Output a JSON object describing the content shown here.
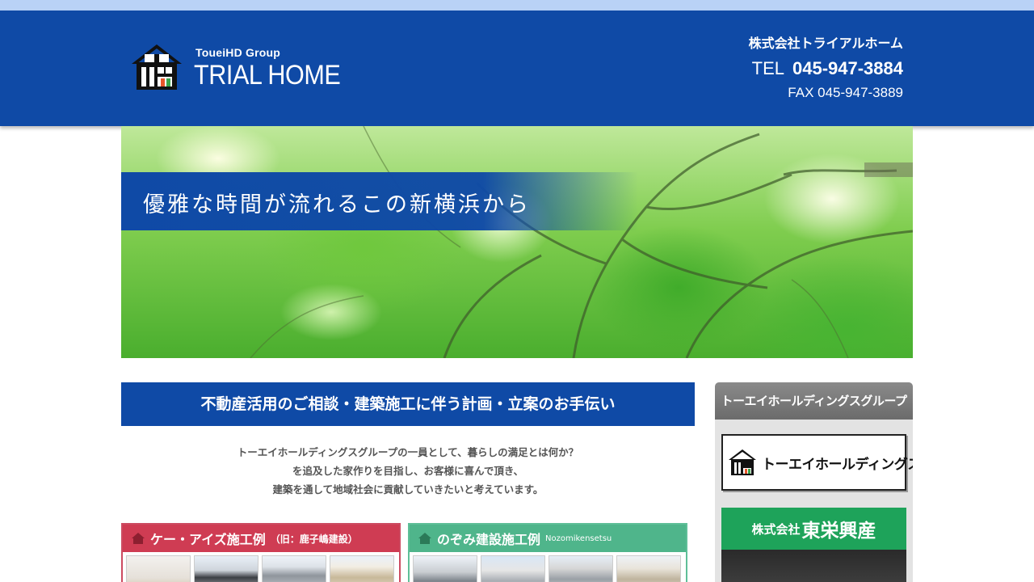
{
  "header": {
    "logo_group": "ToueiHD Group",
    "logo_name": "TRIAL HOME",
    "company": "株式会社トライアルホーム",
    "tel_label": "TEL",
    "tel": "045-947-3884",
    "fax": "FAX 045-947-3889"
  },
  "hero": {
    "catchcopy": "優雅な時間が流れるこの新横浜から"
  },
  "main": {
    "heading": "不動産活用のご相談・建築施工に伴う計画・立案のお手伝い",
    "intro": [
      "トーエイホールディングスグループの一員として、暮らしの満足とは何か？",
      "を追及した家作りを目指し、お客様に喜んで頂き、",
      "建築を通して地域社会に貢献していきたいと考えています。"
    ]
  },
  "cards": {
    "kei": {
      "title": "ケー・アイズ施工例",
      "subtitle": "（旧：鹿子嶋建設）"
    },
    "nozomi": {
      "title": "のぞみ建設施工例",
      "subtitle": "Nozomikensetsu"
    }
  },
  "sidebar": {
    "heading": "トーエイホールディングスグループ",
    "toei_logo_text": "トーエイホールディングス",
    "banner_prefix": "株式会社",
    "banner_name": "東栄興産"
  },
  "colors": {
    "header_blue": "#0f4aa6",
    "kei_red": "#cf3c53",
    "nozomi_green": "#4fb58b",
    "toei_green": "#1ea35a",
    "sidebar_gray": "#6b6b6b"
  }
}
